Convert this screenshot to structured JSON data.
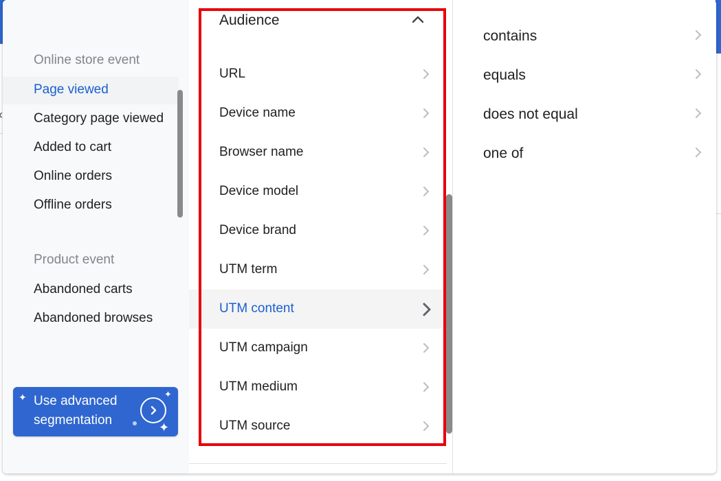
{
  "left_panel": {
    "online_store_header": "Online store event",
    "online_store_items": [
      {
        "label": "Page viewed",
        "active": true
      },
      {
        "label": "Category page viewed",
        "active": false
      },
      {
        "label": "Added to cart",
        "active": false
      },
      {
        "label": "Online orders",
        "active": false
      },
      {
        "label": "Offline orders",
        "active": false
      }
    ],
    "product_header": "Product event",
    "product_items": [
      {
        "label": "Abandoned carts"
      },
      {
        "label": "Abandoned browses"
      }
    ],
    "advanced_button": {
      "label": "Use advanced segmentation",
      "icon": "chevron-right-circle-icon"
    }
  },
  "middle_panel": {
    "header": "Audience",
    "collapse_icon": "chevron-up-icon",
    "items": [
      {
        "label": "URL",
        "active": false
      },
      {
        "label": "Device name",
        "active": false
      },
      {
        "label": "Browser name",
        "active": false
      },
      {
        "label": "Device model",
        "active": false
      },
      {
        "label": "Device brand",
        "active": false
      },
      {
        "label": "UTM term",
        "active": false
      },
      {
        "label": "UTM content",
        "active": true
      },
      {
        "label": "UTM campaign",
        "active": false
      },
      {
        "label": "UTM medium",
        "active": false
      },
      {
        "label": "UTM source",
        "active": false
      }
    ]
  },
  "right_panel": {
    "operators": [
      {
        "label": "contains"
      },
      {
        "label": "equals"
      },
      {
        "label": "does not equal"
      },
      {
        "label": "one of"
      }
    ]
  },
  "colors": {
    "accent": "#1a5fd0",
    "button": "#2f66d0",
    "highlight_border": "#e8000b"
  }
}
